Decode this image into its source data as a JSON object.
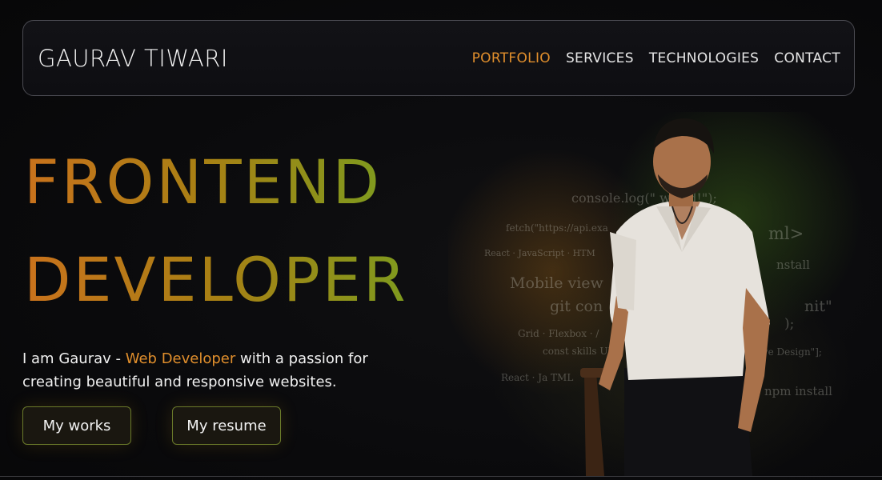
{
  "header": {
    "brand": "GAURAV TIWARI",
    "nav": [
      {
        "label": "PORTFOLIO",
        "active": true
      },
      {
        "label": "SERVICES",
        "active": false
      },
      {
        "label": "TECHNOLOGIES",
        "active": false
      },
      {
        "label": "CONTACT",
        "active": false
      }
    ]
  },
  "hero": {
    "headline_line1": "FRONTEND",
    "headline_line2": "DEVELOPER",
    "intro_prefix": "I am Gaurav - ",
    "intro_highlight": "Web Developer",
    "intro_suffix": " with a passion for creating beautiful and responsive websites.",
    "buttons": {
      "works": "My works",
      "resume": "My resume"
    }
  },
  "background_code": {
    "l1": "console.log(\"          world!\");",
    "l2": "fetch(\"https://api.exa",
    "l3": "ml>",
    "l4": "React · JavaScript · HTM",
    "l5": "nstall",
    "l6": "Mobile view",
    "l7": "git con",
    "l8": "nit\"",
    "l9": ");",
    "l10": "Grid · Flexbox · /",
    "l11": "const skills   UI/",
    "l12": "R    sive Design\"];",
    "l13": "React · Ja       TML",
    "l14": "npm install"
  },
  "colors": {
    "accent": "#e08e2c",
    "gradient_start": "#c9721c",
    "gradient_end": "#7f9a1e",
    "background": "#0a0a0c"
  }
}
